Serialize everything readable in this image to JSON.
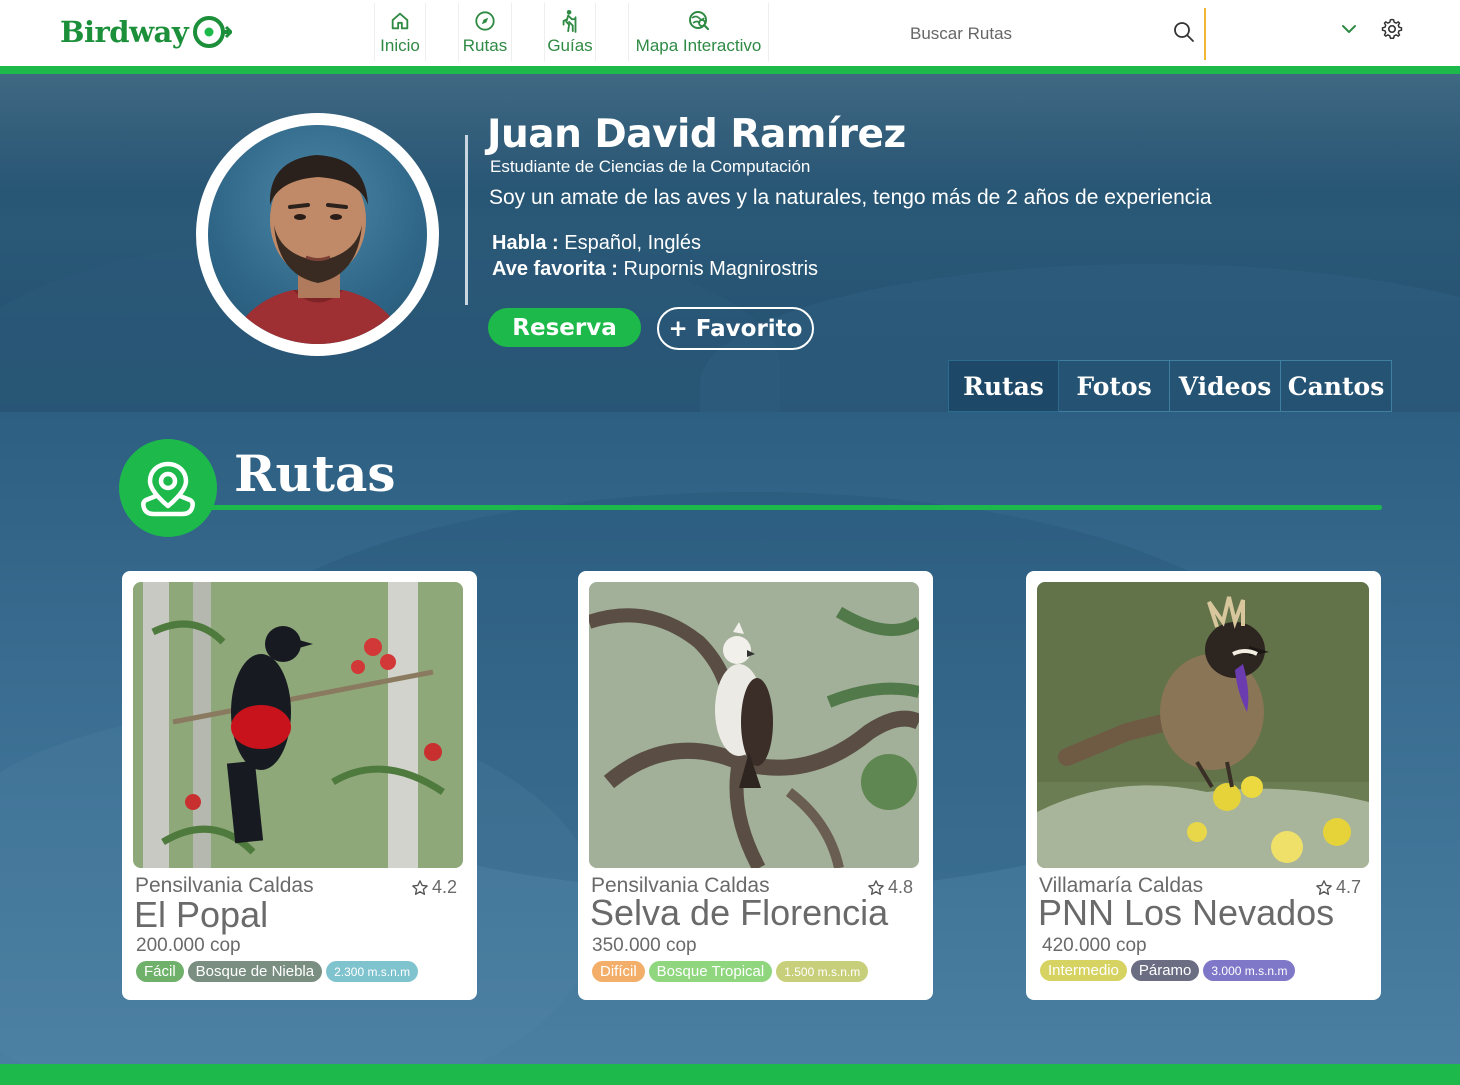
{
  "header": {
    "logo_text": "Birdway",
    "nav": [
      {
        "label": "Inicio",
        "icon": "home-icon"
      },
      {
        "label": "Rutas",
        "icon": "compass-icon"
      },
      {
        "label": "Guías",
        "icon": "hiker-icon"
      },
      {
        "label": "Mapa Interactivo",
        "icon": "map-search-icon"
      }
    ],
    "search_placeholder": "Buscar Rutas",
    "accent_color": "#1db94a"
  },
  "profile": {
    "name": "Juan David Ramírez",
    "role": "Estudiante de Ciencias de la Computación",
    "bio": "Soy un amate de las aves y la naturales, tengo más de 2 años de experiencia",
    "habla_label": "Habla :",
    "habla_value": " Español, Inglés",
    "ave_label": "Ave favorita :",
    "ave_value": " Rupornis Magnirostris",
    "reserva_label": "Reserva",
    "favorito_label": "+ Favorito"
  },
  "tabs": [
    "Rutas",
    "Fotos",
    "Videos",
    "Cantos"
  ],
  "section": {
    "title": "Rutas"
  },
  "routes": [
    {
      "location": "Pensilvania Caldas",
      "rating": "4.2",
      "name": "El Popal",
      "price": "200.000 cop",
      "tags": [
        {
          "text": "Fácil",
          "color": "#6fb06a"
        },
        {
          "text": "Bosque de Niebla",
          "color": "#7a8f82"
        },
        {
          "text": "2.300 m.s.n.m",
          "color": "#7fc3cf"
        }
      ]
    },
    {
      "location": "Pensilvania Caldas",
      "rating": "4.8",
      "name": "Selva de Florencia",
      "price": "350.000 cop",
      "tags": [
        {
          "text": "Difícil",
          "color": "#f3ae6a"
        },
        {
          "text": "Bosque Tropical",
          "color": "#8fd67f"
        },
        {
          "text": "1.500 m.s.n.m",
          "color": "#c8cf7a"
        }
      ]
    },
    {
      "location": "Villamaría Caldas",
      "rating": "4.7",
      "name": "PNN Los Nevados",
      "price": "420.000 cop",
      "tags": [
        {
          "text": "Intermedio",
          "color": "#d6d363"
        },
        {
          "text": "Páramo",
          "color": "#6b6e82"
        },
        {
          "text": "3.000 m.s.n.m",
          "color": "#7f78c8"
        }
      ]
    }
  ]
}
